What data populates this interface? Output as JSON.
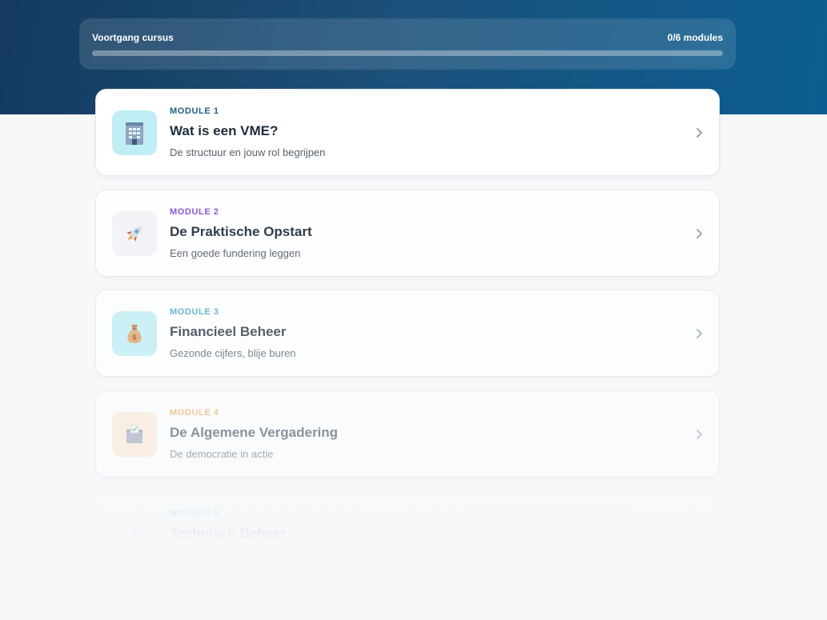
{
  "progress": {
    "title": "Voortgang cursus",
    "count": "0/6 modules",
    "fraction": 0
  },
  "modules": [
    {
      "label": "MODULE 1",
      "title": "Wat is een VME?",
      "subtitle": "De structuur en jouw rol begrijpen",
      "label_color": "#1e5f86",
      "icon_bg": "#bfeef5",
      "icon": "building-icon",
      "opacity": 1
    },
    {
      "label": "MODULE 2",
      "title": "De Praktische Opstart",
      "subtitle": "Een goede fundering leggen",
      "label_color": "#7b4fd6",
      "icon_bg": "#f1f3f6",
      "icon": "rocket-icon",
      "opacity": 0.92
    },
    {
      "label": "MODULE 3",
      "title": "Financieel Beheer",
      "subtitle": "Gezonde cijfers, blije buren",
      "label_color": "#3aa3c6",
      "icon_bg": "#bdeef4",
      "icon": "money-bag-icon",
      "opacity": 0.75
    },
    {
      "label": "MODULE 4",
      "title": "De Algemene Vergadering",
      "subtitle": "De democratie in actie",
      "label_color": "#e89a3c",
      "icon_bg": "#fde6cc",
      "icon": "ballot-box-icon",
      "opacity": 0.5
    },
    {
      "label": "MODULE 5",
      "title": "Technisch Beheer",
      "subtitle": "Zorgen dat het gebouw in topconditie blijft",
      "label_color": "#37c5dc",
      "icon_bg": "#eef1f4",
      "icon": "wrench-icon",
      "opacity": 0.22
    }
  ]
}
